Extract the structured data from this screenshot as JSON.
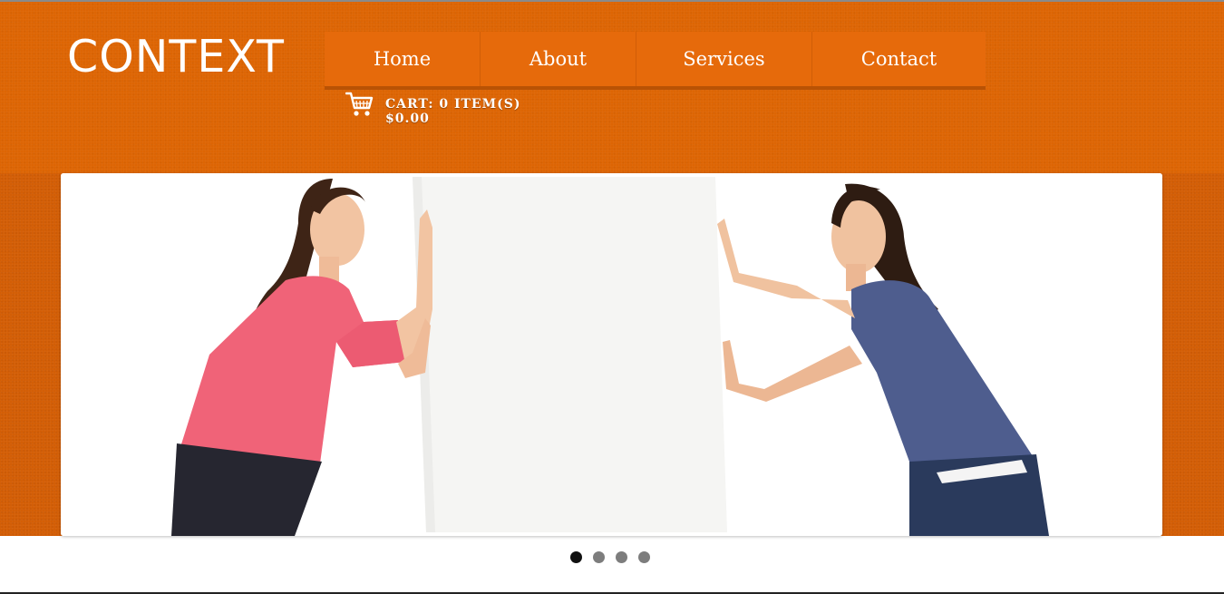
{
  "site": {
    "logo": "CONTEXT"
  },
  "nav": {
    "items": [
      {
        "label": "Home"
      },
      {
        "label": "About"
      },
      {
        "label": "Services"
      },
      {
        "label": "Contact"
      }
    ]
  },
  "cart": {
    "icon": "shopping-cart-icon",
    "summary": "CART: 0 ITEM(S)",
    "total": "$0.00"
  },
  "slider": {
    "slide_count": 4,
    "active_slide": 1
  },
  "colors": {
    "header": "#dd6504",
    "band": "#d35e06",
    "nav": "#e66a0b",
    "dot_active": "#111111",
    "dot_inactive": "#7d7d7d"
  }
}
